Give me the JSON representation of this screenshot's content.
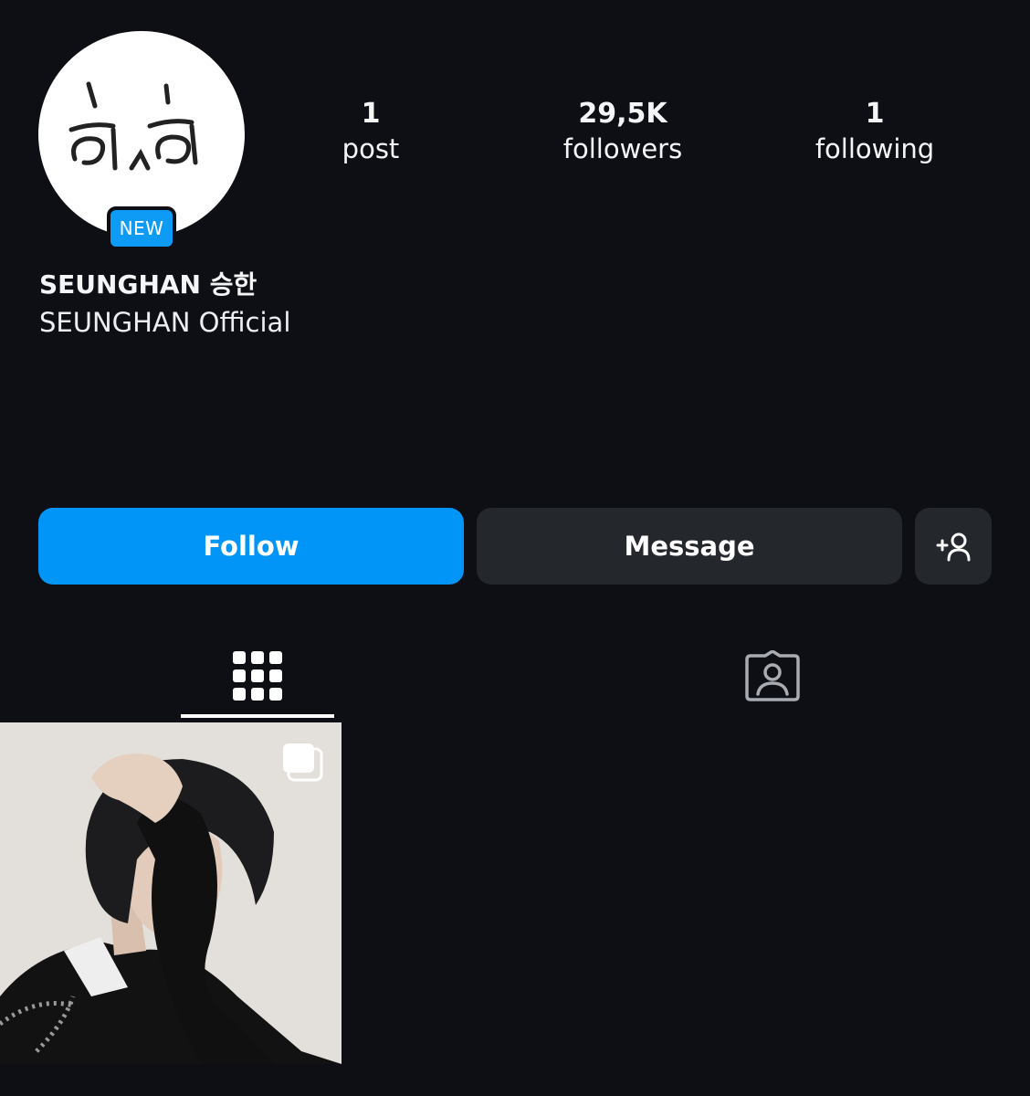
{
  "profile": {
    "avatar_badge": "NEW",
    "display_name": "SEUNGHAN 승한",
    "category": "SEUNGHAN Official"
  },
  "stats": [
    {
      "value": "1",
      "label": "post"
    },
    {
      "value": "29,5K",
      "label": "followers"
    },
    {
      "value": "1",
      "label": "following"
    }
  ],
  "actions": {
    "follow_label": "Follow",
    "message_label": "Message",
    "add_user_icon": "person-add-icon"
  },
  "tabs": [
    {
      "name": "posts-grid",
      "icon": "grid-icon",
      "selected": true
    },
    {
      "name": "tagged",
      "icon": "tagged-person-icon",
      "selected": false
    }
  ],
  "posts": [
    {
      "type": "carousel",
      "icon": "multiple-photos-icon"
    }
  ],
  "colors": {
    "background": "#0d0f14",
    "accent": "#0095f6",
    "secondary_button": "#24272c",
    "text": "#f4f5f7"
  }
}
